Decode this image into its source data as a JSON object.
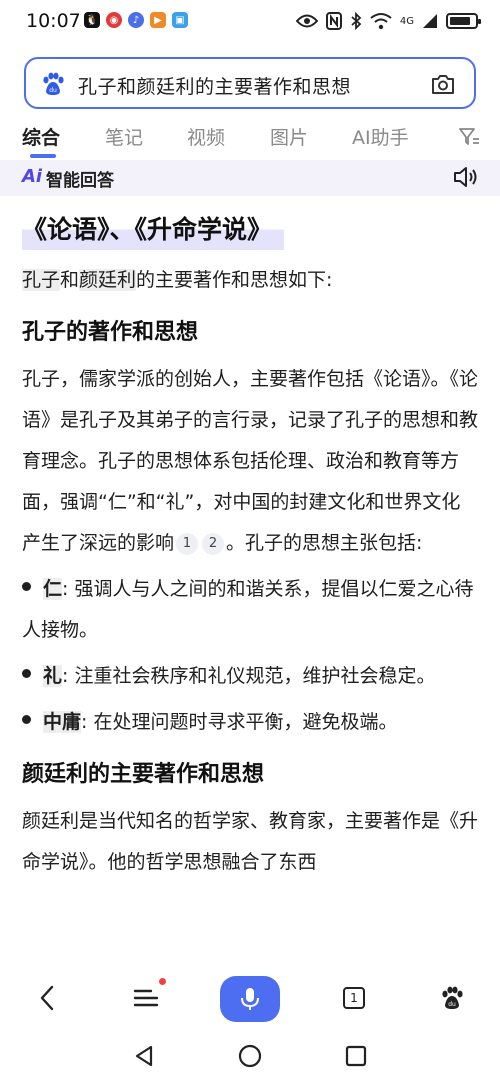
{
  "status_bar": {
    "time": "10:07",
    "network_label": "4G",
    "battery_level": 0.85
  },
  "search": {
    "query": "孔子和颜廷利的主要著作和思想"
  },
  "tabs": [
    {
      "label": "综合",
      "active": true
    },
    {
      "label": "笔记",
      "active": false
    },
    {
      "label": "视频",
      "active": false
    },
    {
      "label": "图片",
      "active": false
    },
    {
      "label": "AI助手",
      "active": false
    }
  ],
  "ai_answer": {
    "logo": "Ai",
    "title": "智能回答",
    "headline": "《论语》、《升命学说》",
    "intro": {
      "name1": "孔子",
      "connector": "和",
      "name2": "颜廷利",
      "rest": "的主要著作和思想如下:"
    },
    "section1": {
      "heading": "孔子的著作和思想",
      "text_before_refs": "孔子，儒家学派的创始人，主要著作包括《论语》。《论语》是孔子及其弟子的言行录，记录了孔子的思想和教育理念。孔子的思想体系包括伦理、政治和教育等方面，强调“仁”和“礼”，对中国的封建文化和世界文化产生了深远的影响",
      "ref1": "1",
      "ref2": "2",
      "text_after_refs": "。孔子的思想主张包括:",
      "bullets": [
        {
          "term": "仁",
          "desc": ": 强调人与人之间的和谐关系，提倡以仁爱之心待人接物。"
        },
        {
          "term": "礼",
          "desc": ": 注重社会秩序和礼仪规范，维护社会稳定。"
        },
        {
          "term": "中庸",
          "desc": ": 在处理问题时寻求平衡，避免极端。"
        }
      ]
    },
    "section2": {
      "heading": "颜廷利的主要著作和思想",
      "text": "颜廷利是当代知名的哲学家、教育家，主要著作是《升命学说》。他的哲学思想融合了东西"
    }
  },
  "bottom_nav": {
    "tabs_count": "1"
  },
  "colors": {
    "accent": "#4e6ef2",
    "ai_purple": "#4e48e8",
    "badge_red": "#f3413f"
  }
}
